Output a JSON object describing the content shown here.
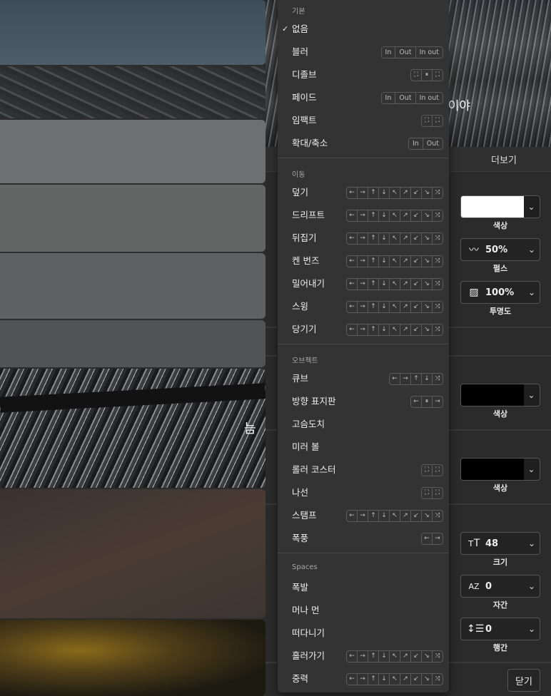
{
  "preview": {
    "overlay_text": "|이야"
  },
  "panel": {
    "more_tab": "더보기",
    "color1": {
      "caption": "색상",
      "swatch": "#ffffff"
    },
    "pulse": {
      "value": "50%",
      "caption": "펄스"
    },
    "opacity": {
      "value": "100%",
      "caption": "투명도"
    },
    "color2": {
      "caption": "색상",
      "swatch": "#000000"
    },
    "color3": {
      "caption": "색상",
      "swatch": "#000000"
    },
    "size": {
      "value": "48",
      "caption": "크기"
    },
    "letter_spacing": {
      "value": "0",
      "caption": "자간"
    },
    "line_spacing": {
      "value": "0",
      "caption": "행간"
    },
    "close": "닫기"
  },
  "slide_text": "늠",
  "menu": {
    "sections": {
      "basic": "기본",
      "motion": "이동",
      "object": "오브젝트",
      "spaces": "Spaces"
    },
    "basic_items": [
      {
        "label": "없음",
        "checked": true
      },
      {
        "label": "블러",
        "opts": [
          "In",
          "Out",
          "In out"
        ]
      },
      {
        "label": "디졸브",
        "icons": [
          "⛶",
          "⏸",
          "⛶"
        ]
      },
      {
        "label": "페이드",
        "opts": [
          "In",
          "Out",
          "In out"
        ]
      },
      {
        "label": "임팩트",
        "icons": [
          "⛶",
          "⛶"
        ]
      },
      {
        "label": "확대/축소",
        "opts": [
          "In",
          "Out"
        ]
      }
    ],
    "motion_items": [
      {
        "label": "덮기",
        "icons": [
          "←",
          "→",
          "↑",
          "↓",
          "↖",
          "↗",
          "↙",
          "↘",
          "⤨"
        ]
      },
      {
        "label": "드리프트",
        "icons": [
          "←",
          "→",
          "↑",
          "↓",
          "↖",
          "↗",
          "↙",
          "↘",
          "⤨"
        ]
      },
      {
        "label": "뒤집기",
        "icons": [
          "←",
          "→",
          "↑",
          "↓",
          "↖",
          "↗",
          "↙",
          "↘",
          "⤨"
        ]
      },
      {
        "label": "켄 번즈",
        "icons": [
          "←",
          "→",
          "↑",
          "↓",
          "↖",
          "↗",
          "↙",
          "↘",
          "⤨"
        ]
      },
      {
        "label": "밀어내기",
        "icons": [
          "←",
          "→",
          "↑",
          "↓",
          "↖",
          "↗",
          "↙",
          "↘",
          "⤨"
        ]
      },
      {
        "label": "스윙",
        "icons": [
          "←",
          "→",
          "↑",
          "↓",
          "↖",
          "↗",
          "↙",
          "↘",
          "⤨"
        ]
      },
      {
        "label": "당기기",
        "icons": [
          "←",
          "→",
          "↑",
          "↓",
          "↖",
          "↗",
          "↙",
          "↘",
          "⤨"
        ]
      }
    ],
    "object_items": [
      {
        "label": "큐브",
        "icons": [
          "←",
          "→",
          "↑",
          "↓",
          "⤨"
        ]
      },
      {
        "label": "방향 표지판",
        "icons": [
          "←",
          "⏸",
          "→"
        ]
      },
      {
        "label": "고슴도치"
      },
      {
        "label": "미러 볼"
      },
      {
        "label": "롤러 코스터",
        "icons": [
          "⛶",
          "⛶"
        ]
      },
      {
        "label": "나선",
        "icons": [
          "⛶",
          "⛶"
        ]
      },
      {
        "label": "스탬프",
        "icons": [
          "←",
          "→",
          "↑",
          "↓",
          "↖",
          "↗",
          "↙",
          "↘",
          "⤨"
        ]
      },
      {
        "label": "폭풍",
        "icons": [
          "←",
          "→"
        ]
      }
    ],
    "spaces_items": [
      {
        "label": "폭발"
      },
      {
        "label": "머나 먼"
      },
      {
        "label": "떠다니기"
      },
      {
        "label": "흘러가기",
        "icons": [
          "←",
          "→",
          "↑",
          "↓",
          "↖",
          "↗",
          "↙",
          "↘",
          "⤨"
        ]
      },
      {
        "label": "중력",
        "icons": [
          "←",
          "→",
          "↑",
          "↓",
          "↖",
          "↗",
          "↙",
          "↘",
          "⤨"
        ]
      }
    ]
  }
}
